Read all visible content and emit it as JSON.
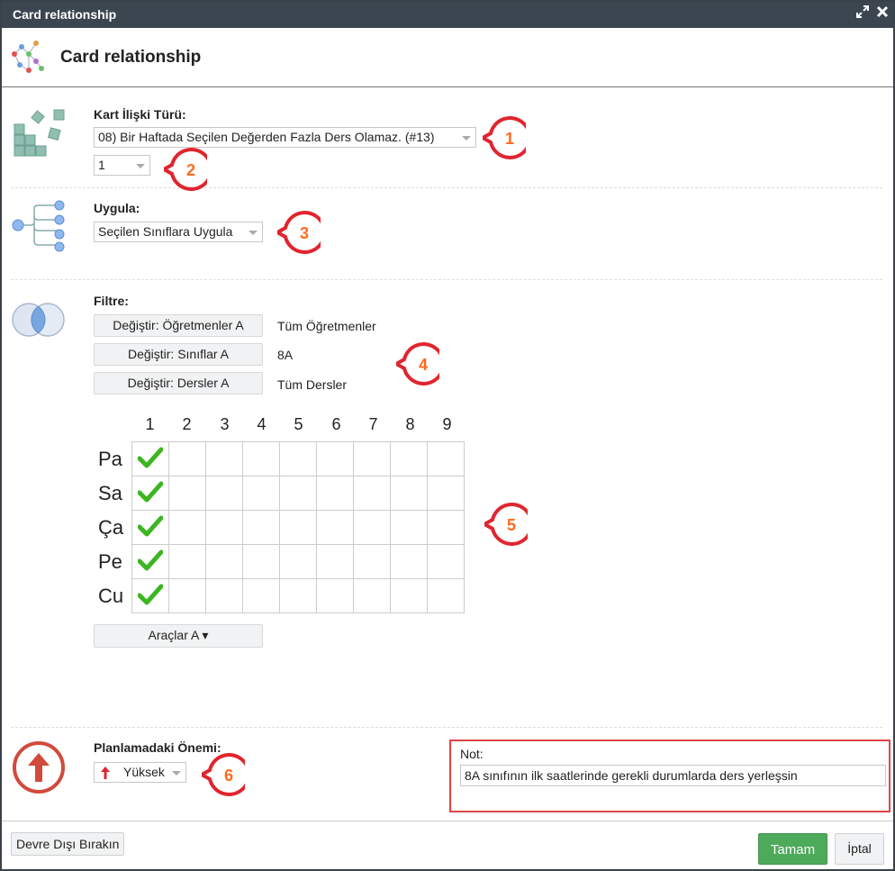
{
  "window": {
    "title": "Card relationship",
    "maximize_icon": "expand-icon",
    "close_icon": "close-icon"
  },
  "header": {
    "title": "Card relationship",
    "icon": "network-graph-icon"
  },
  "relation_type": {
    "label": "Kart İlişki Türü:",
    "selected": "08) Bir Haftada Seçilen Değerden Fazla Ders Olamaz. (#13)",
    "count_selected": "1"
  },
  "apply": {
    "label": "Uygula:",
    "selected": "Seçilen Sınıflara Uygula"
  },
  "filter": {
    "label": "Filtre:",
    "rows": [
      {
        "button": "Değiştir: Öğretmenler A",
        "value": "Tüm Öğretmenler"
      },
      {
        "button": "Değiştir: Sınıflar A",
        "value": "8A"
      },
      {
        "button": "Değiştir: Dersler A",
        "value": "Tüm Dersler"
      }
    ]
  },
  "grid": {
    "periods": [
      "1",
      "2",
      "3",
      "4",
      "5",
      "6",
      "7",
      "8",
      "9"
    ],
    "days": [
      "Pa",
      "Sa",
      "Ça",
      "Pe",
      "Cu"
    ],
    "checked": [
      [
        true,
        false,
        false,
        false,
        false,
        false,
        false,
        false,
        false
      ],
      [
        true,
        false,
        false,
        false,
        false,
        false,
        false,
        false,
        false
      ],
      [
        true,
        false,
        false,
        false,
        false,
        false,
        false,
        false,
        false
      ],
      [
        true,
        false,
        false,
        false,
        false,
        false,
        false,
        false,
        false
      ],
      [
        true,
        false,
        false,
        false,
        false,
        false,
        false,
        false,
        false
      ]
    ]
  },
  "tools_button": "Araçlar A ▾",
  "priority": {
    "label": "Planlamadaki Önemi:",
    "selected": "Yüksek",
    "icon": "up-arrow-icon"
  },
  "note": {
    "label": "Not:",
    "value": "8A sınıfının ilk saatlerinde gerekli durumlarda ders yerleşsin"
  },
  "footer": {
    "disable": "Devre Dışı Bırakın",
    "ok": "Tamam",
    "cancel": "İptal"
  },
  "callouts": [
    "1",
    "2",
    "3",
    "4",
    "5",
    "6"
  ],
  "colors": {
    "titlebar": "#3b4650",
    "ok": "#4caa5a",
    "callout": "#e0252e",
    "callout_text": "#ff6a1a",
    "check": "#3cb521",
    "icon_teal": "#8fbfb0",
    "icon_blue": "#6a9fe0"
  }
}
